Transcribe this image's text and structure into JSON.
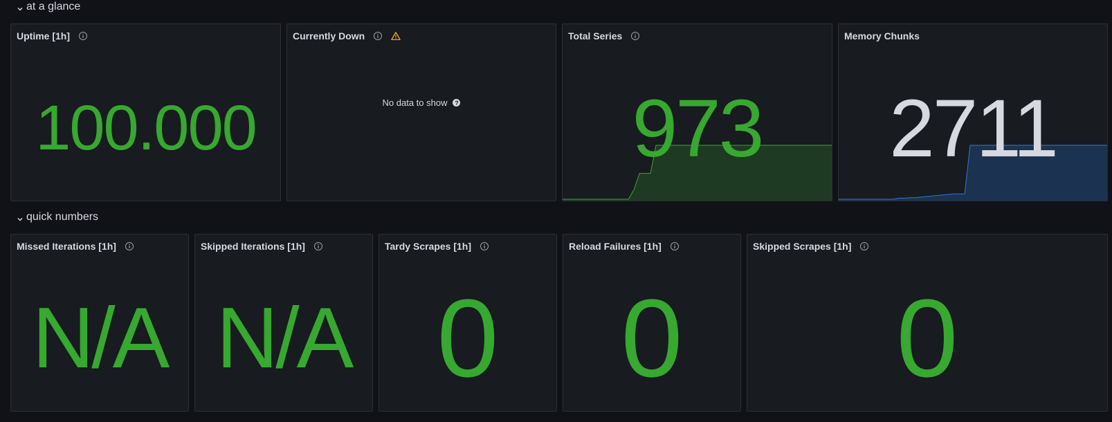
{
  "rows": [
    {
      "title": "at a glance"
    },
    {
      "title": "quick numbers"
    }
  ],
  "panels": {
    "uptime": {
      "title": "Uptime [1h]",
      "value": "100.000",
      "color": "#37a830"
    },
    "currently_down": {
      "title": "Currently Down",
      "no_data": "No data to show",
      "warning_color": "#f5a623"
    },
    "total_series": {
      "title": "Total Series",
      "value": "973",
      "color": "#37a830",
      "sparkline": [
        0,
        0,
        0,
        0,
        0,
        0,
        0,
        0,
        0,
        0,
        0,
        0,
        0,
        0.18,
        0.48,
        0.48,
        0.48,
        1,
        1,
        1,
        1,
        1,
        1,
        1,
        1,
        1,
        1,
        1,
        1,
        1,
        1,
        1,
        1,
        1,
        1,
        1,
        1,
        1,
        1,
        1,
        1,
        1,
        1,
        1,
        1,
        1,
        1,
        1,
        1,
        1
      ]
    },
    "memory_chunks": {
      "title": "Memory Chunks",
      "value": "2711",
      "color": "#d8d9e0",
      "sparkline": [
        0,
        0,
        0,
        0,
        0,
        0,
        0,
        0,
        0,
        0,
        0,
        0.02,
        0.02,
        0.03,
        0.03,
        0.04,
        0.05,
        0.06,
        0.07,
        0.08,
        0.09,
        0.1,
        0.1,
        0.1,
        1,
        1,
        1,
        1,
        1,
        1,
        1,
        1,
        1,
        1,
        1,
        1,
        1,
        1,
        1,
        1,
        1,
        1,
        1,
        1,
        1,
        1,
        1,
        1,
        1,
        1
      ]
    },
    "missed_iterations": {
      "title": "Missed Iterations [1h]",
      "value": "N/A"
    },
    "skipped_iterations": {
      "title": "Skipped Iterations [1h]",
      "value": "N/A"
    },
    "tardy_scrapes": {
      "title": "Tardy Scrapes [1h]",
      "value": "0"
    },
    "reload_failures": {
      "title": "Reload Failures [1h]",
      "value": "0"
    },
    "skipped_scrapes": {
      "title": "Skipped Scrapes [1h]",
      "value": "0"
    }
  },
  "icons": {
    "row_toggle": "chevron-down-icon",
    "panel_info": "info-icon",
    "warning": "warning-icon",
    "help": "help-icon"
  },
  "colors": {
    "value_green": "#37a830",
    "series_green_fill": "#1f3a22",
    "series_blue_line": "#3274d9",
    "series_blue_fill": "#1b3350",
    "panel_bg": "#181b1f",
    "page_bg": "#111217"
  }
}
